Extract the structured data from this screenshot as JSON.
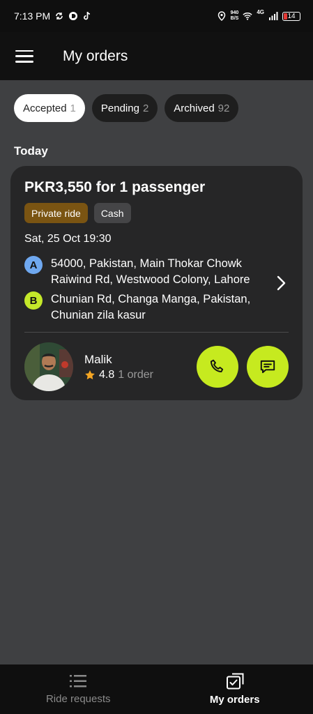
{
  "status_bar": {
    "time": "7:13 PM",
    "net_speed_value": "940",
    "net_speed_unit": "B/S",
    "network": "4G",
    "battery": "14"
  },
  "app_bar": {
    "title": "My orders"
  },
  "tabs": [
    {
      "label": "Accepted",
      "count": "1"
    },
    {
      "label": "Pending",
      "count": "2"
    },
    {
      "label": "Archived",
      "count": "92"
    }
  ],
  "section": {
    "label": "Today"
  },
  "order": {
    "title": "PKR3,550 for 1 passenger",
    "tags": {
      "ride_type": "Private ride",
      "payment": "Cash"
    },
    "datetime": "Sat, 25 Oct 19:30",
    "pickup": {
      "badge": "A",
      "address": "54000, Pakistan, Main Thokar Chowk Raiwind Rd, Westwood Colony, Lahore"
    },
    "dropoff": {
      "badge": "B",
      "address": "Chunian Rd, Changa Manga, Pakistan, Chunian zila kasur"
    },
    "driver": {
      "name": "Malik",
      "rating": "4.8",
      "orders": "1 order"
    }
  },
  "bottom_nav": {
    "ride_requests": "Ride requests",
    "my_orders": "My orders"
  },
  "colors": {
    "accent": "#c6ea1f",
    "private_ride_tag": "#7a5412",
    "pickup_badge": "#6fa8f0",
    "star": "#f5a623"
  }
}
